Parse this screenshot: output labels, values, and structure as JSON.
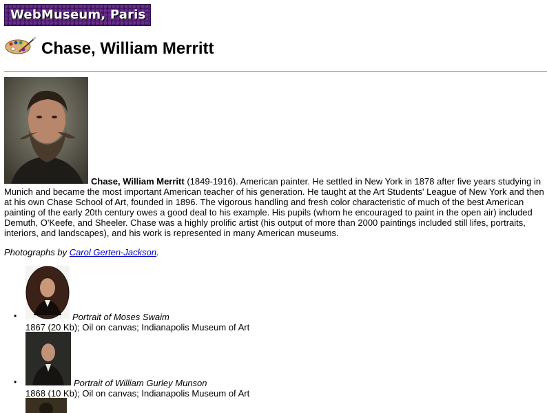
{
  "site": {
    "banner": "WebMuseum, Paris"
  },
  "artist": {
    "name": "Chase, William Merritt",
    "bio_name": "Chase, William Merritt",
    "bio_text": " (1849-1916). American painter. He settled in New York in 1878 after five years studying in Munich and became the most important American teacher of his generation. He taught at the Art Students' League of New York and then at his own Chase School of Art, founded in 1896. The vigorous handling and fresh color characteristic of much of the best American painting of the early 20th century owes a good deal to his example. His pupils (whom he encouraged to paint in the open air) included Demuth, O'Keefe, and Sheeler. Chase was a highly prolific artist (his output of more than 2000 paintings included still lifes, portraits, interiors, and landscapes), and his work is represented in many American museums."
  },
  "credit": {
    "prefix": "Photographs by ",
    "link": "Carol Gerten-Jackson",
    "suffix": "."
  },
  "works": [
    {
      "title": "Portrait of Moses Swaim",
      "details": "1867 (20 Kb); Oil on canvas; Indianapolis Museum of Art"
    },
    {
      "title": "Portrait of William Gurley Munson",
      "details": "1868 (10 Kb); Oil on canvas; Indianapolis Museum of Art"
    }
  ],
  "colors": {
    "banner_bg": "#4a1d6e",
    "link": "#0000cc"
  },
  "icons": [
    "palette-icon"
  ]
}
